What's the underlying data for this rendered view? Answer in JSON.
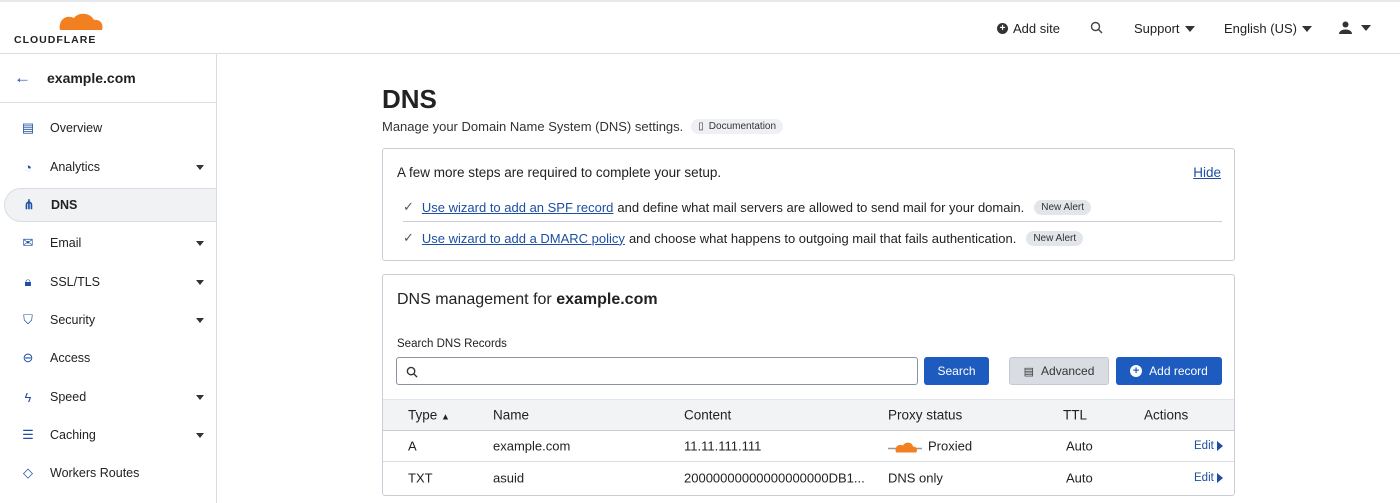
{
  "brand": {
    "name": "CLOUDFLARE",
    "color": "#f38020"
  },
  "topbar": {
    "add_site": "Add site",
    "support": "Support",
    "language": "English (US)"
  },
  "sidebar": {
    "domain": "example.com",
    "items": [
      {
        "label": "Overview",
        "icon": "clipboard-icon",
        "dropdown": false
      },
      {
        "label": "Analytics",
        "icon": "pie-chart-icon",
        "dropdown": true
      },
      {
        "label": "DNS",
        "icon": "network-icon",
        "dropdown": false,
        "active": true
      },
      {
        "label": "Email",
        "icon": "email-icon",
        "dropdown": true
      },
      {
        "label": "SSL/TLS",
        "icon": "lock-icon",
        "dropdown": true
      },
      {
        "label": "Security",
        "icon": "shield-icon",
        "dropdown": true
      },
      {
        "label": "Access",
        "icon": "access-icon",
        "dropdown": false
      },
      {
        "label": "Speed",
        "icon": "lightning-icon",
        "dropdown": true
      },
      {
        "label": "Caching",
        "icon": "server-icon",
        "dropdown": true
      },
      {
        "label": "Workers Routes",
        "icon": "workers-icon",
        "dropdown": false
      }
    ]
  },
  "page": {
    "title": "DNS",
    "subtitle": "Manage your Domain Name System (DNS) settings.",
    "documentation": "Documentation"
  },
  "alert": {
    "title": "A few more steps are required to complete your setup.",
    "hide": "Hide",
    "steps": [
      {
        "link": "Use wizard to add an SPF record",
        "text": "and define what mail servers are allowed to send mail for your domain.",
        "badge": "New Alert"
      },
      {
        "link": "Use wizard to add a DMARC policy",
        "text": "and choose what happens to outgoing mail that fails authentication.",
        "badge": "New Alert"
      }
    ]
  },
  "management": {
    "title_prefix": "DNS management for",
    "domain": "example.com",
    "search_label": "Search DNS Records",
    "search_value": "",
    "search_button": "Search",
    "advanced_button": "Advanced",
    "add_record_button": "Add record",
    "columns": [
      "Type",
      "Name",
      "Content",
      "Proxy status",
      "TTL",
      "Actions"
    ],
    "rows": [
      {
        "type": "A",
        "name": "example.com",
        "content": "11.11.111.111",
        "proxy": "Proxied",
        "proxied": true,
        "ttl": "Auto",
        "action": "Edit"
      },
      {
        "type": "TXT",
        "name": "asuid",
        "content": "20000000000000000000DB1...",
        "proxy": "DNS only",
        "proxied": false,
        "ttl": "Auto",
        "action": "Edit"
      }
    ]
  }
}
